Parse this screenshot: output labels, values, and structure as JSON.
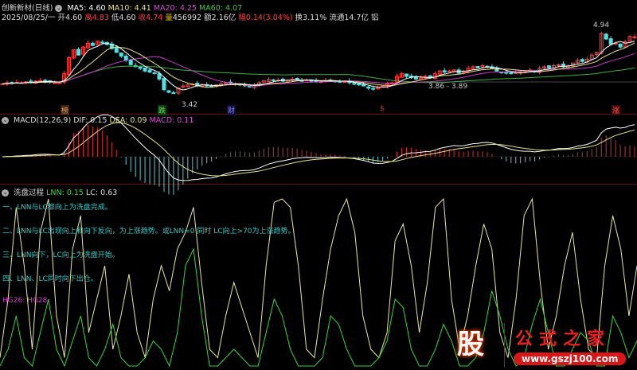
{
  "header": {
    "title": "创新新材(日线)",
    "ma5": "MA5: 4.60",
    "ma10": "MA10: 4.41",
    "ma20": "MA20: 4.25",
    "ma60": "MA60: 4.07",
    "date": "2025/08/25/一",
    "open_l": "开",
    "open": "4.60",
    "high_l": "高",
    "high": "4.83",
    "low_l": "低",
    "low": "4.60",
    "close_l": "收",
    "close": "4.74",
    "vol_l": "量",
    "vol": "456992",
    "amt": "额2.16亿",
    "chg_l": "幅",
    "chg": "0.14(3.04%)",
    "turnover": "换3.11%",
    "float": "流通14.7亿 铝"
  },
  "macd": {
    "title": "MACD(12,26,9)",
    "dif": "DIF: 0.15",
    "dea": "DEA: 0.09",
    "macd": "MACD: 0.11"
  },
  "wash": {
    "title": "洗盘过程",
    "lnn": "LNN: 0.15",
    "lc": "LC: 0.63",
    "notes": [
      "一、LNN与LC都向上为洗盘完成。",
      "二、LNN与LC出现向上和向下反向，为上涨趋势。或LNN=0 同时 LC向上>70为上涨趋势。",
      "三、LNN向下，LC向上为洗盘开始。",
      "四、LNN、LC同时向下出仓。"
    ],
    "hg": "HG26: HG28"
  },
  "annotations": {
    "low_label": "3.42",
    "range_label": "3.86 - 3.89",
    "high_label": "4.94"
  },
  "markers": [
    "榜",
    "跌",
    "财",
    "$",
    "涨"
  ],
  "watermark": {
    "logo": "股",
    "name": "公式之家",
    "url": "www.gszj100.com"
  },
  "colors": {
    "up": "#ff4040",
    "down": "#54e0e0",
    "ma5": "#ffffff",
    "ma10": "#e6e08a",
    "ma20": "#c040c0",
    "ma60": "#3fb040",
    "lnn": "#3fd040",
    "lc": "#e8e8a0"
  },
  "chart_data": {
    "type": "candlestick",
    "closes": [
      3.86,
      3.88,
      3.87,
      3.89,
      3.88,
      3.9,
      3.89,
      3.91,
      3.92,
      3.9,
      3.89,
      3.88,
      3.88,
      4.05,
      4.35,
      4.5,
      4.4,
      4.55,
      4.62,
      4.58,
      4.66,
      4.64,
      4.6,
      4.52,
      4.45,
      4.38,
      4.3,
      4.22,
      4.18,
      4.15,
      4.1,
      4.08,
      4.05,
      3.95,
      3.75,
      3.7,
      3.68,
      3.78,
      3.82,
      3.84,
      3.86,
      3.83,
      3.85,
      3.82,
      3.8,
      3.84,
      3.86,
      3.88,
      3.87,
      3.86,
      3.84,
      3.82,
      3.8,
      3.83,
      3.88,
      3.92,
      3.94,
      3.92,
      3.93,
      3.91,
      3.93,
      3.95,
      3.94,
      3.92,
      3.93,
      3.91,
      3.9,
      3.9,
      3.92,
      3.93,
      3.91,
      3.89,
      3.9,
      3.88,
      3.86,
      3.84,
      3.82,
      3.78,
      3.76,
      3.8,
      3.82,
      3.86,
      3.88,
      4.0,
      4.05,
      4.0,
      3.98,
      3.95,
      3.97,
      4.0,
      3.98,
      4.05,
      4.1,
      4.08,
      4.1,
      4.12,
      4.06,
      4.1,
      4.15,
      4.18,
      4.16,
      4.2,
      4.18,
      4.15,
      4.1,
      4.08,
      4.06,
      4.05,
      4.07,
      4.08,
      4.1,
      4.12,
      4.08,
      4.15,
      4.18,
      4.16,
      4.2,
      4.22,
      4.18,
      4.2,
      4.25,
      4.3,
      4.28,
      4.32,
      4.4,
      4.45,
      4.8,
      4.7,
      4.6,
      4.62,
      4.55,
      4.65,
      4.75,
      4.74
    ],
    "price_range": [
      3.42,
      4.94
    ],
    "lc": [
      5,
      40,
      95,
      60,
      10,
      80,
      100,
      30,
      5,
      70,
      90,
      20,
      40,
      60,
      10,
      30,
      55,
      20,
      5,
      40,
      60,
      45,
      70,
      80,
      95,
      50,
      10,
      5,
      30,
      50,
      35,
      20,
      5,
      60,
      98,
      100,
      95,
      60,
      10,
      5,
      40,
      70,
      90,
      100,
      80,
      30,
      10,
      5,
      20,
      75,
      85,
      60,
      20,
      50,
      95,
      100,
      40,
      10,
      30,
      60,
      85,
      70,
      20,
      5,
      40,
      90,
      100,
      50,
      10,
      30,
      60,
      80,
      40,
      10,
      5,
      60,
      90,
      70,
      30,
      60
    ],
    "lnn": [
      0,
      10,
      30,
      5,
      0,
      20,
      40,
      10,
      0,
      15,
      30,
      5,
      0,
      10,
      25,
      5,
      0,
      0,
      5,
      15,
      10,
      0,
      20,
      60,
      70,
      30,
      0,
      0,
      5,
      10,
      5,
      0,
      0,
      20,
      40,
      30,
      10,
      0,
      0,
      0,
      5,
      30,
      25,
      10,
      0,
      0,
      0,
      5,
      15,
      40,
      35,
      10,
      0,
      0,
      10,
      25,
      15,
      0,
      0,
      5,
      20,
      45,
      30,
      10,
      0,
      5,
      25,
      40,
      20,
      0,
      0,
      10,
      20,
      15,
      0,
      0,
      30,
      20,
      5,
      15
    ]
  }
}
